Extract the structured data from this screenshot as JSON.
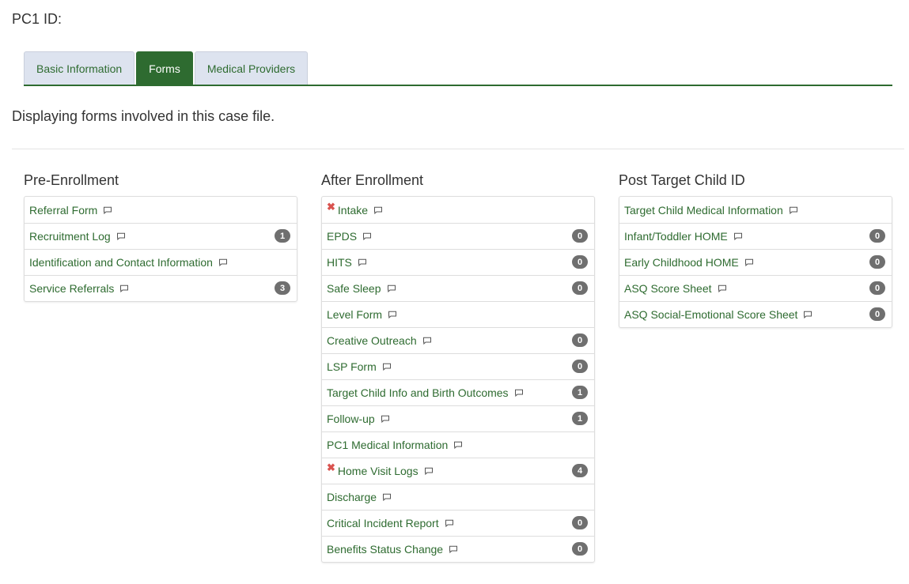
{
  "header": {
    "pc1_label": "PC1 ID:"
  },
  "tabs": [
    {
      "label": "Basic Information",
      "active": false
    },
    {
      "label": "Forms",
      "active": true
    },
    {
      "label": "Medical Providers",
      "active": false
    }
  ],
  "description": "Displaying forms involved in this case file.",
  "colors": {
    "accent": "#2e6b30",
    "tab_inactive_bg": "#dde3ef",
    "badge_bg": "#6f6f6f",
    "error_icon": "#d9534f"
  },
  "columns": [
    {
      "title": "Pre-Enrollment",
      "items": [
        {
          "label": "Referral Form",
          "badge": null,
          "error": false
        },
        {
          "label": "Recruitment Log",
          "badge": "1",
          "error": false
        },
        {
          "label": "Identification and Contact Information",
          "badge": null,
          "error": false
        },
        {
          "label": "Service Referrals",
          "badge": "3",
          "error": false
        }
      ]
    },
    {
      "title": "After Enrollment",
      "items": [
        {
          "label": "Intake",
          "badge": null,
          "error": true
        },
        {
          "label": "EPDS",
          "badge": "0",
          "error": false
        },
        {
          "label": "HITS",
          "badge": "0",
          "error": false
        },
        {
          "label": "Safe Sleep",
          "badge": "0",
          "error": false
        },
        {
          "label": "Level Form",
          "badge": null,
          "error": false
        },
        {
          "label": "Creative Outreach",
          "badge": "0",
          "error": false
        },
        {
          "label": "LSP Form",
          "badge": "0",
          "error": false
        },
        {
          "label": "Target Child Info and Birth Outcomes",
          "badge": "1",
          "error": false
        },
        {
          "label": "Follow-up",
          "badge": "1",
          "error": false
        },
        {
          "label": "PC1 Medical Information",
          "badge": null,
          "error": false
        },
        {
          "label": "Home Visit Logs",
          "badge": "4",
          "error": true
        },
        {
          "label": "Discharge",
          "badge": null,
          "error": false
        },
        {
          "label": "Critical Incident Report",
          "badge": "0",
          "error": false
        },
        {
          "label": "Benefits Status Change",
          "badge": "0",
          "error": false
        }
      ]
    },
    {
      "title": "Post Target Child ID",
      "items": [
        {
          "label": "Target Child Medical Information",
          "badge": null,
          "error": false
        },
        {
          "label": "Infant/Toddler HOME",
          "badge": "0",
          "error": false
        },
        {
          "label": "Early Childhood HOME",
          "badge": "0",
          "error": false
        },
        {
          "label": "ASQ Score Sheet",
          "badge": "0",
          "error": false
        },
        {
          "label": "ASQ Social-Emotional Score Sheet",
          "badge": "0",
          "error": false
        }
      ]
    }
  ]
}
